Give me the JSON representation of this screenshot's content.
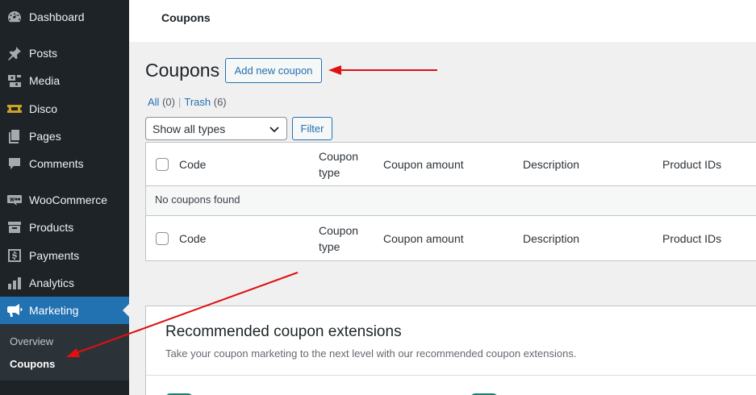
{
  "sidebar": {
    "items": [
      {
        "label": "Dashboard",
        "icon": "dashboard-icon"
      },
      {
        "label": "Posts",
        "icon": "pin-icon"
      },
      {
        "label": "Media",
        "icon": "media-icon"
      },
      {
        "label": "Disco",
        "icon": "ticket-icon"
      },
      {
        "label": "Pages",
        "icon": "pages-icon"
      },
      {
        "label": "Comments",
        "icon": "comment-icon"
      },
      {
        "label": "WooCommerce",
        "icon": "woo-icon"
      },
      {
        "label": "Products",
        "icon": "archive-icon"
      },
      {
        "label": "Payments",
        "icon": "dollar-icon"
      },
      {
        "label": "Analytics",
        "icon": "bar-chart-icon"
      },
      {
        "label": "Marketing",
        "icon": "megaphone-icon"
      }
    ],
    "submenu": [
      {
        "label": "Overview"
      },
      {
        "label": "Coupons"
      }
    ]
  },
  "topbar": {
    "title": "Coupons"
  },
  "page": {
    "title": "Coupons",
    "add_new_label": "Add new coupon",
    "views": {
      "all_label": "All",
      "all_count": "(0)",
      "separator": "|",
      "trash_label": "Trash",
      "trash_count": "(6)"
    },
    "type_filter": {
      "selected": "Show all types"
    },
    "filter_label": "Filter"
  },
  "table": {
    "columns": [
      "Code",
      "Coupon type",
      "Coupon amount",
      "Description",
      "Product IDs"
    ],
    "empty_message": "No coupons found"
  },
  "recommended": {
    "title": "Recommended coupon extensions",
    "description": "Take your coupon marketing to the next level with our recommended coupon extensions."
  },
  "colors": {
    "sidebar_bg": "#1d2327",
    "active_bg": "#2271b1",
    "link": "#2271b1",
    "annotation_arrow": "#e01010"
  }
}
